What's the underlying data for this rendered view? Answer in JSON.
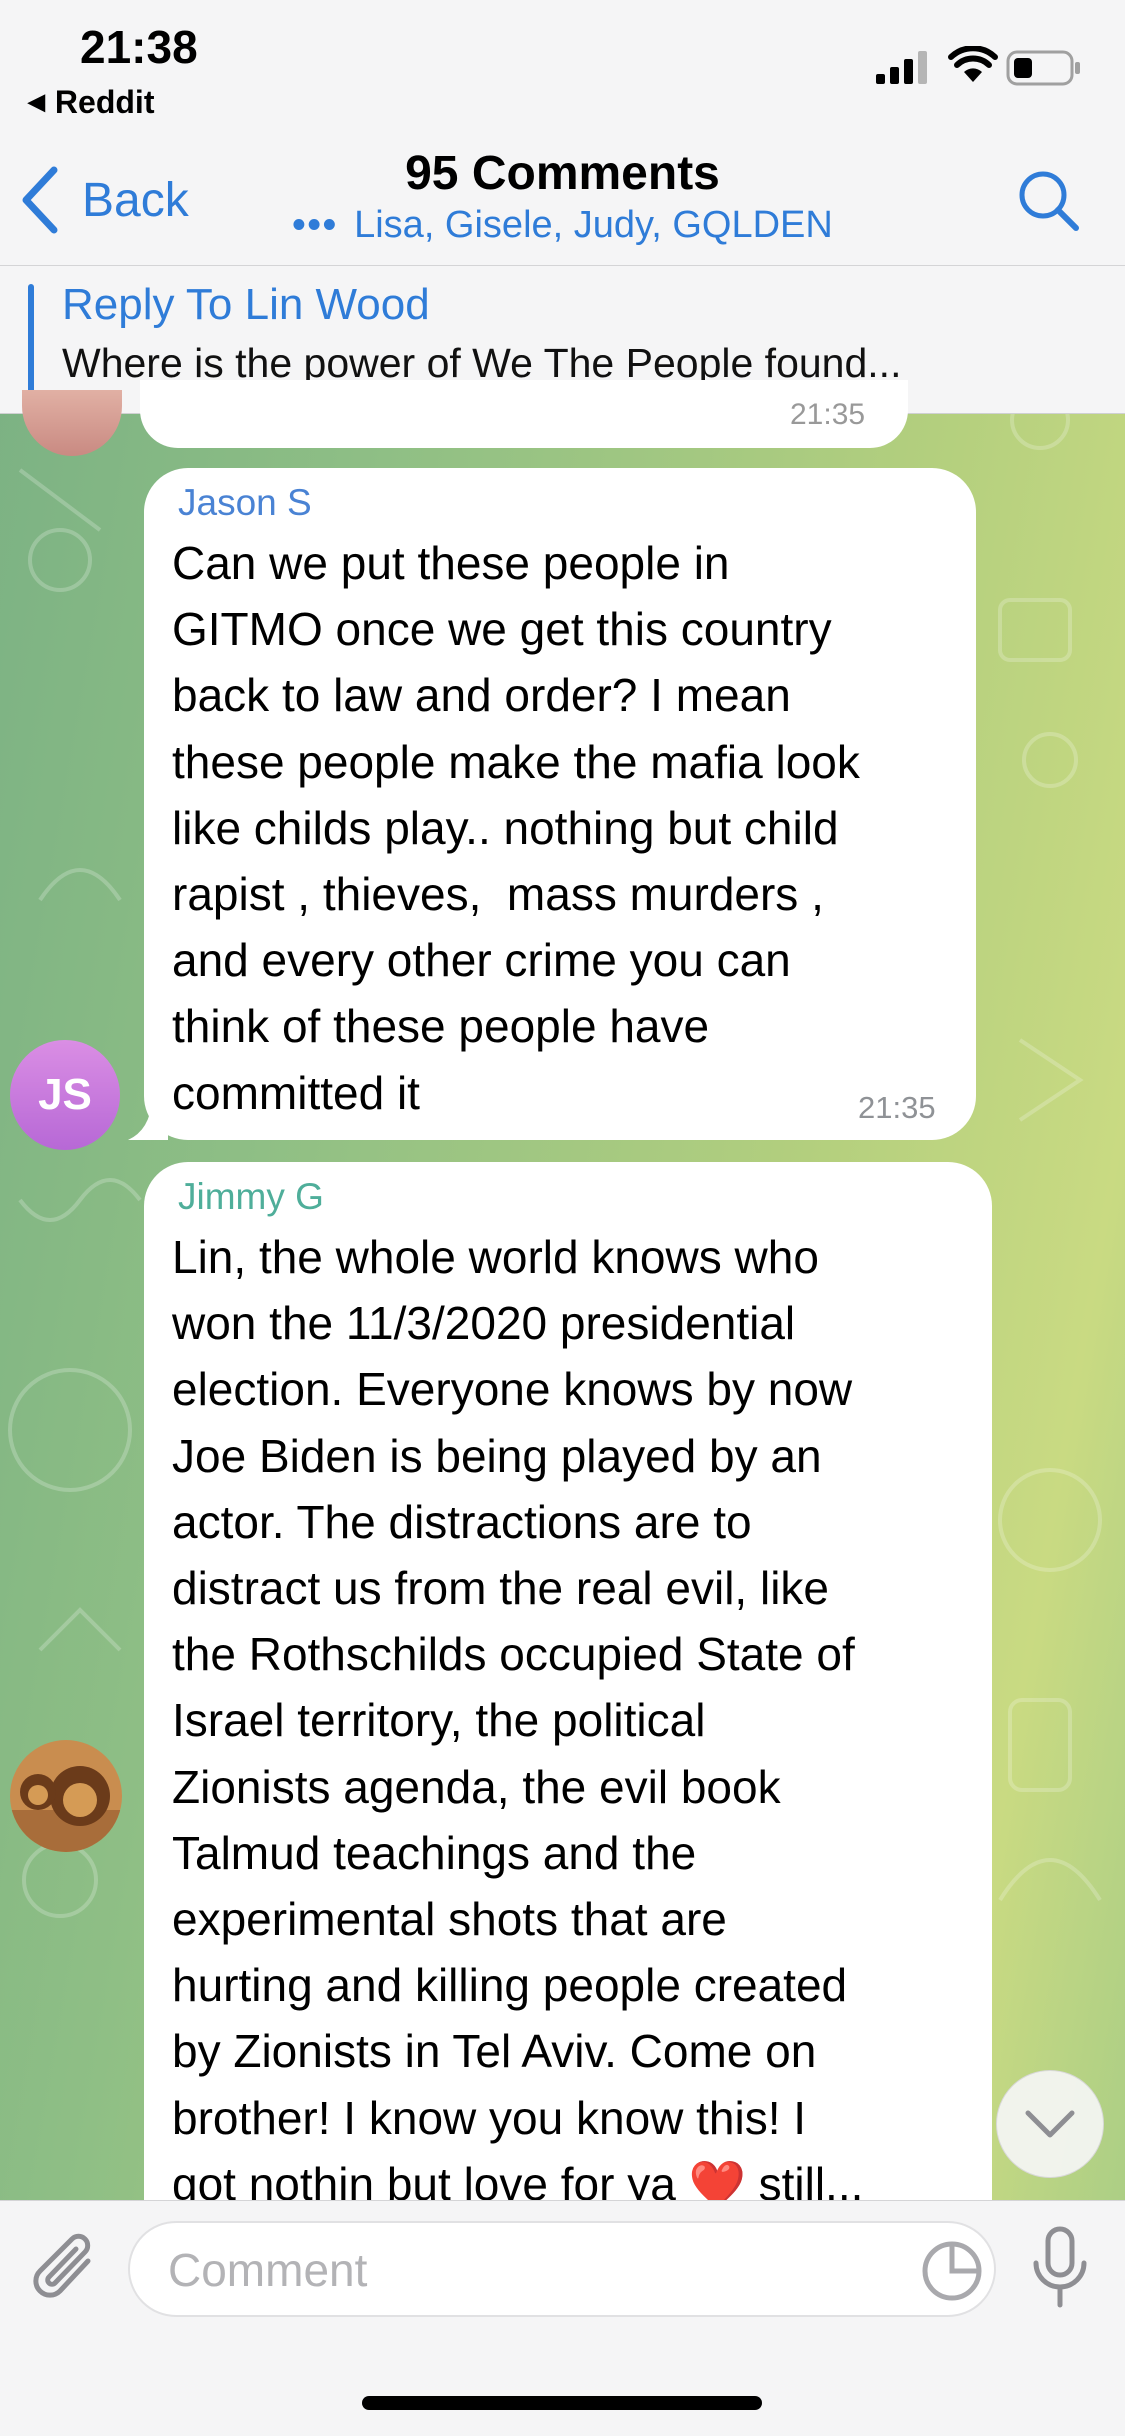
{
  "status_bar": {
    "time": "21:38",
    "back_to_app": "Reddit",
    "icons": [
      "cellular-signal-icon",
      "wifi-icon",
      "battery-icon"
    ]
  },
  "nav": {
    "back_label": "Back",
    "title": "95 Comments",
    "subtitle": "Lisa, Gisele, Judy, GQLDEN",
    "search_icon": "search-icon"
  },
  "reply": {
    "title": "Reply To Lin Wood",
    "text": "Where is the power of We The People found..."
  },
  "previous_message": {
    "time": "21:35"
  },
  "messages": [
    {
      "sender": "Jason S",
      "avatar_initials": "JS",
      "lines": [
        "Can we put these people in",
        "GITMO once we get this country",
        "back to law and order? I mean",
        "these people make the mafia look",
        "like childs play.. nothing but child",
        "rapist , thieves,  mass murders ,",
        "and every other crime you can",
        "think of these people have",
        "committed it"
      ],
      "time": "21:35"
    },
    {
      "sender": "Jimmy G",
      "avatar": "lion-photo",
      "lines": [
        "Lin, the whole world knows who",
        "won the 11/3/2020 presidential",
        "election. Everyone knows by now",
        "Joe Biden is being played by an",
        "actor. The distractions are to",
        "distract us from the real evil, like",
        "the Rothschilds occupied State of",
        "Israel territory, the political",
        "Zionists agenda, the evil book",
        "Talmud teachings and the",
        "experimental shots that are",
        "hurting and killing people created",
        "by Zionists in Tel Aviv. Come on",
        "brother! I know you know this! I",
        "got nothin but love for ya ❤️ still..."
      ]
    }
  ],
  "input": {
    "placeholder": "Comment",
    "attach_icon": "paperclip-icon",
    "sticker_icon": "sticker-icon",
    "mic_icon": "microphone-icon"
  },
  "colors": {
    "accent": "#2f7cd8",
    "jason_name": "#4a83d4",
    "jimmy_name": "#4fae9a",
    "bubble": "#ffffff",
    "bar_bg": "#f5f5f6"
  }
}
